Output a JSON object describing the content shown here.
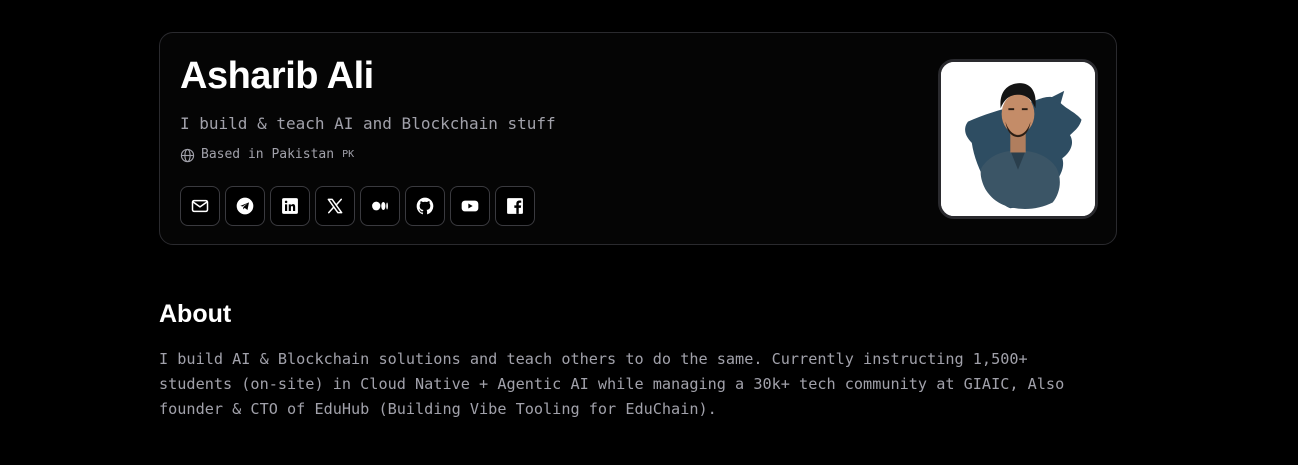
{
  "profile": {
    "name": "Asharib Ali",
    "tagline": "I build & teach AI and Blockchain stuff",
    "location": "Based in Pakistan",
    "country_code": "PK"
  },
  "socials": [
    {
      "name": "email",
      "icon": "mail-icon"
    },
    {
      "name": "telegram",
      "icon": "telegram-icon"
    },
    {
      "name": "linkedin",
      "icon": "linkedin-icon"
    },
    {
      "name": "x",
      "icon": "x-icon"
    },
    {
      "name": "medium",
      "icon": "medium-icon"
    },
    {
      "name": "github",
      "icon": "github-icon"
    },
    {
      "name": "youtube",
      "icon": "youtube-icon"
    },
    {
      "name": "facebook",
      "icon": "facebook-icon"
    }
  ],
  "about": {
    "title": "About",
    "lines": [
      "I build AI & Blockchain solutions and teach others to do the same. Currently instructing 1,500+",
      "students (on-site) in Cloud Native + Agentic AI while managing a 30k+ tech community at GIAIC, Also",
      "founder & CTO of EduHub (Building Vibe Tooling for EduChain)."
    ]
  },
  "colors": {
    "background": "#000000",
    "border": "#2a2a2e",
    "muted_text": "#a1a1aa",
    "text": "#ffffff"
  }
}
